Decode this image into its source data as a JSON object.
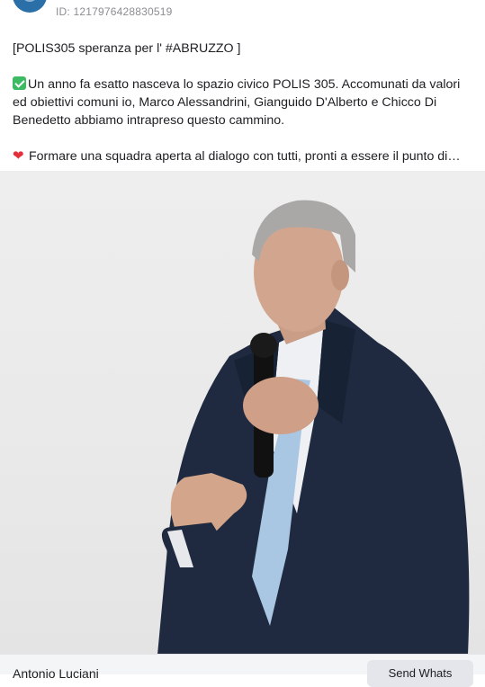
{
  "post": {
    "id_label": "ID: 1217976428830519",
    "paragraph_1": "[POLIS305 speranza per l' #ABRUZZO ]",
    "paragraph_2": "Un anno fa esatto nasceva lo spazio civico POLIS 305. Accomunati da valori ed obiettivi comuni io, Marco Alessandrini, Gianguido D'Alberto e Chicco Di Benedetto abbiamo intrapreso questo cammino.",
    "paragraph_3": "Formare una squadra aperta al dialogo con tutti, pronti a essere il punto di…",
    "emoji_2": "check-mark-emoji",
    "emoji_3": "heart-emoji"
  },
  "footer": {
    "name": "Antonio Luciani",
    "send_button": "Send Whats"
  },
  "colors": {
    "text": "#1c1e21",
    "muted": "#8a8d91",
    "check_green": "#3dbb63",
    "heart_red": "#e5303c",
    "button_bg": "#e4e6eb"
  }
}
